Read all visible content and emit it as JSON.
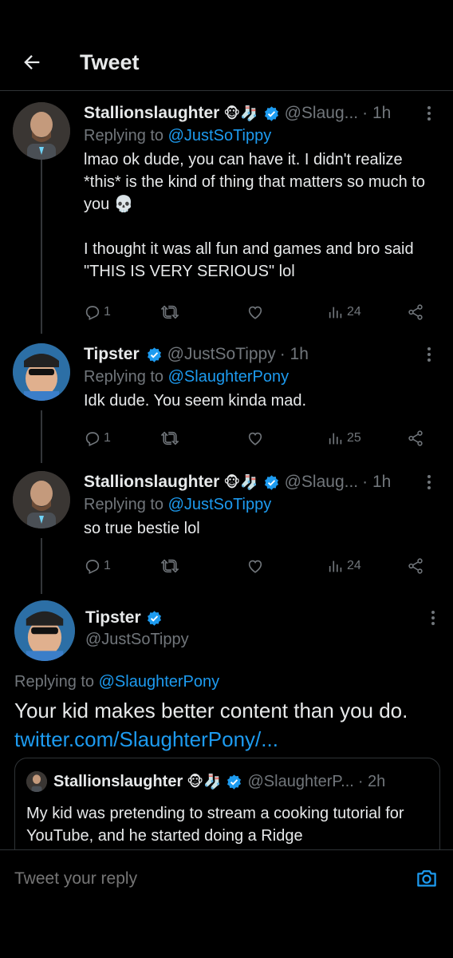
{
  "header": {
    "title": "Tweet"
  },
  "tweets": [
    {
      "name": "Stallionslaughter",
      "emojis": "🐵🧦",
      "handle": "@Slaug...",
      "time": "· 1h",
      "replying_prefix": "Replying to ",
      "replying_to": "@JustSoTippy",
      "text": "lmao ok dude, you can have it. I didn't realize *this* is the kind of thing that matters so much to you 💀\n\nI thought it was all fun and games and bro said \"THIS IS VERY SERIOUS\" lol",
      "replies": "1",
      "retweets": "",
      "likes": "",
      "views": "24"
    },
    {
      "name": "Tipster",
      "emojis": "",
      "handle": "@JustSoTippy",
      "time": "· 1h",
      "replying_prefix": "Replying to ",
      "replying_to": "@SlaughterPony",
      "text": "Idk dude. You seem kinda mad.",
      "replies": "1",
      "retweets": "",
      "likes": "",
      "views": "25"
    },
    {
      "name": "Stallionslaughter",
      "emojis": "🐵🧦",
      "handle": "@Slaug...",
      "time": "· 1h",
      "replying_prefix": "Replying to ",
      "replying_to": "@JustSoTippy",
      "text": "so true bestie lol",
      "replies": "1",
      "retweets": "",
      "likes": "",
      "views": "24"
    }
  ],
  "main_tweet": {
    "name": "Tipster",
    "handle": "@JustSoTippy",
    "replying_prefix": "Replying to ",
    "replying_to": "@SlaughterPony",
    "text": "Your kid makes better content than you do.",
    "link": "twitter.com/SlaughterPony/..."
  },
  "quote": {
    "name": "Stallionslaughter",
    "emojis": "🐵🧦",
    "handle": "@SlaughterP...",
    "time": "· 2h",
    "text": "My kid was pretending to stream a cooking tutorial for YouTube, and he started doing a Ridge"
  },
  "reply_bar": {
    "placeholder": "Tweet your reply"
  },
  "colors": {
    "accent": "#1d9bf0",
    "background": "#000000",
    "muted": "#71767b",
    "text": "#e7e9ea"
  }
}
